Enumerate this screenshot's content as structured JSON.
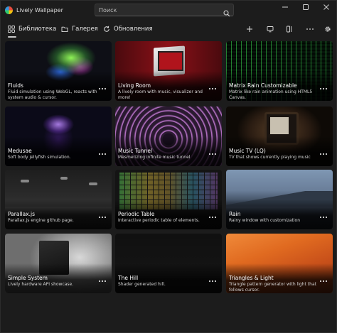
{
  "app": {
    "title": "Lively Wallpaper"
  },
  "search": {
    "placeholder": "Поиск"
  },
  "nav": {
    "tabs": [
      {
        "label": "Библиотека",
        "icon": "grid-icon"
      },
      {
        "label": "Галерея",
        "icon": "folder-icon"
      },
      {
        "label": "Обновления",
        "icon": "refresh-icon"
      }
    ],
    "active_tab": "Библиотека",
    "tools": [
      "add-icon",
      "monitor-icon",
      "control-panel-icon",
      "more-icon",
      "settings-icon"
    ]
  },
  "wallpapers": [
    {
      "title": "Fluids",
      "description": "Fluid simulation using WebGL, reacts with system audio & cursor."
    },
    {
      "title": "Living Room",
      "description": "A lively room with music, visualizer and more!"
    },
    {
      "title": "Matrix Rain Customizable",
      "description": "Matrix like rain animation using HTML5 Canvas."
    },
    {
      "title": "Medusae",
      "description": "Soft body jellyfish simulation."
    },
    {
      "title": "Music Tunnel",
      "description": "Mesmerizing infinite music tunnel"
    },
    {
      "title": "Music TV (LQ)",
      "description": "TV that shows currently playing music"
    },
    {
      "title": "Parallax.js",
      "description": "Parallax.js engine github page."
    },
    {
      "title": "Periodic Table",
      "description": "Interactive periodic table of elements."
    },
    {
      "title": "Rain",
      "description": "Rainy window with customization"
    },
    {
      "title": "Simple System",
      "description": "Lively hardware API showcase."
    },
    {
      "title": "The Hill",
      "description": "Shader generated hill."
    },
    {
      "title": "Triangles & Light",
      "description": "Triangle pattern generator with light that follows cursor."
    }
  ]
}
